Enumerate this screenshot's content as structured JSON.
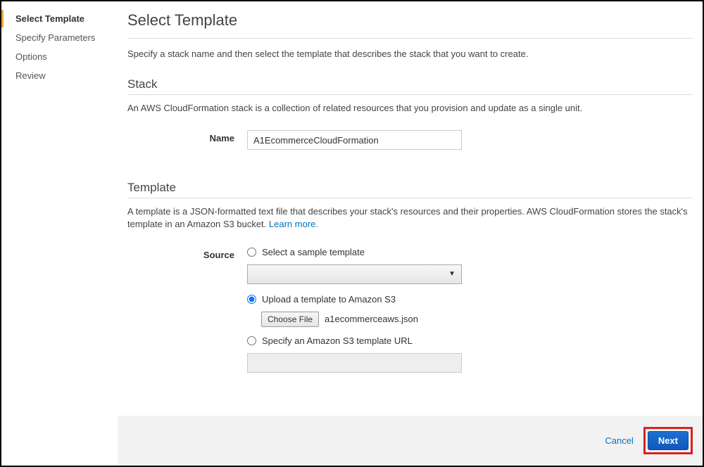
{
  "sidebar": {
    "items": [
      {
        "label": "Select Template",
        "active": true
      },
      {
        "label": "Specify Parameters",
        "active": false
      },
      {
        "label": "Options",
        "active": false
      },
      {
        "label": "Review",
        "active": false
      }
    ]
  },
  "page": {
    "title": "Select Template",
    "description": "Specify a stack name and then select the template that describes the stack that you want to create."
  },
  "stack": {
    "heading": "Stack",
    "desc": "An AWS CloudFormation stack is a collection of related resources that you provision and update as a single unit.",
    "name_label": "Name",
    "name_value": "A1EcommerceCloudFormation"
  },
  "template": {
    "heading": "Template",
    "desc_prefix": "A template is a JSON-formatted text file that describes your stack's resources and their properties. AWS CloudFormation stores the stack's template in an Amazon S3 bucket. ",
    "learn_more": "Learn more.",
    "source_label": "Source",
    "option_sample": "Select a sample template",
    "option_upload": "Upload a template to Amazon S3",
    "option_url": "Specify an Amazon S3 template URL",
    "choose_file_label": "Choose File",
    "file_name": "a1ecommerceaws.json"
  },
  "footer": {
    "cancel": "Cancel",
    "next": "Next"
  }
}
